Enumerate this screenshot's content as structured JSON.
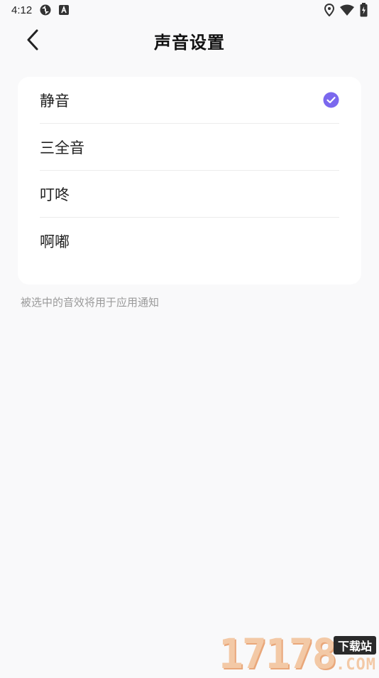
{
  "status_bar": {
    "time": "4:12",
    "icons": [
      "sync-icon",
      "a-icon",
      "location-icon",
      "wifi-icon",
      "battery-icon"
    ]
  },
  "header": {
    "title": "声音设置",
    "back_icon": "back-arrow-icon"
  },
  "sound_options": [
    {
      "label": "静音",
      "selected": true
    },
    {
      "label": "三全音",
      "selected": false
    },
    {
      "label": "叮咚",
      "selected": false
    },
    {
      "label": "啊嘟",
      "selected": false
    }
  ],
  "hint": "被选中的音效将用于应用通知",
  "accent_color": "#7b68ee",
  "watermark": {
    "digits": "17178",
    "site": "下载站",
    "com": ".COM"
  }
}
